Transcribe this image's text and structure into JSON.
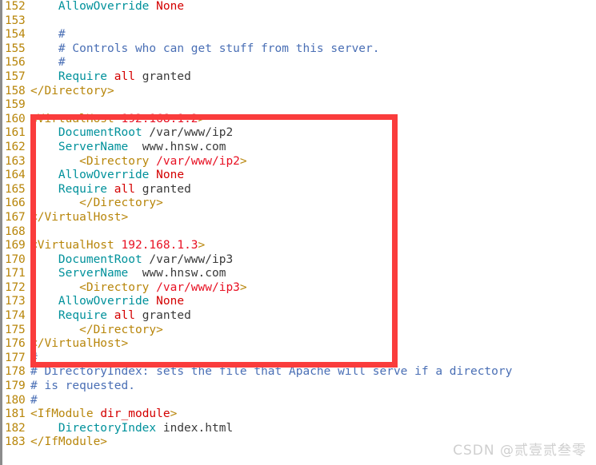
{
  "document": {
    "type": "apache-config",
    "first_visible_line": 152,
    "last_visible_line": 183,
    "watermark": "CSDN @贰壹贰叁零",
    "colors": {
      "background": "#ffffff",
      "gutter_number": "#b8860b",
      "comment": "#4a6fb5",
      "tag": "#b8860b",
      "tag_value": "#e81123",
      "directive": "#00919b",
      "keyword": "#d40000",
      "plain_text": "#3a3a3a",
      "annotation_box": "#fa3c3c",
      "watermark": "#cfcfcf"
    }
  },
  "annotation": {
    "name": "red-highlight-rectangle",
    "covers_lines": "160-176",
    "color": "#fa3c3c"
  },
  "lines": [
    {
      "num": "152",
      "tokens": [
        {
          "t": "plain",
          "v": "    "
        },
        {
          "t": "directive",
          "v": "AllowOverride"
        },
        {
          "t": "plain",
          "v": " "
        },
        {
          "t": "keyword",
          "v": "None"
        }
      ]
    },
    {
      "num": "153",
      "tokens": [
        {
          "t": "plain",
          "v": ""
        }
      ]
    },
    {
      "num": "154",
      "tokens": [
        {
          "t": "comment",
          "v": "    #"
        }
      ]
    },
    {
      "num": "155",
      "tokens": [
        {
          "t": "comment",
          "v": "    # Controls who can get stuff from this server."
        }
      ]
    },
    {
      "num": "156",
      "tokens": [
        {
          "t": "comment",
          "v": "    #"
        }
      ]
    },
    {
      "num": "157",
      "tokens": [
        {
          "t": "plain",
          "v": "    "
        },
        {
          "t": "directive",
          "v": "Require"
        },
        {
          "t": "plain",
          "v": " "
        },
        {
          "t": "keyword",
          "v": "all"
        },
        {
          "t": "plain",
          "v": " granted"
        }
      ]
    },
    {
      "num": "158",
      "tokens": [
        {
          "t": "tag",
          "v": "</Directory>"
        }
      ]
    },
    {
      "num": "159",
      "tokens": [
        {
          "t": "plain",
          "v": ""
        }
      ]
    },
    {
      "num": "160",
      "tokens": [
        {
          "t": "tag",
          "v": "<VirtualHost "
        },
        {
          "t": "tagval",
          "v": "192.168.1.2"
        },
        {
          "t": "tag",
          "v": ">"
        }
      ]
    },
    {
      "num": "161",
      "tokens": [
        {
          "t": "plain",
          "v": "    "
        },
        {
          "t": "directive",
          "v": "DocumentRoot"
        },
        {
          "t": "plain",
          "v": " /var/www/ip2"
        }
      ]
    },
    {
      "num": "162",
      "tokens": [
        {
          "t": "plain",
          "v": "    "
        },
        {
          "t": "directive",
          "v": "ServerName"
        },
        {
          "t": "plain",
          "v": "  www.hnsw.com"
        }
      ]
    },
    {
      "num": "163",
      "tokens": [
        {
          "t": "plain",
          "v": "       "
        },
        {
          "t": "tag",
          "v": "<Directory "
        },
        {
          "t": "tagval",
          "v": "/var/www/ip2"
        },
        {
          "t": "tag",
          "v": ">"
        }
      ]
    },
    {
      "num": "164",
      "tokens": [
        {
          "t": "plain",
          "v": "    "
        },
        {
          "t": "directive",
          "v": "AllowOverride"
        },
        {
          "t": "plain",
          "v": " "
        },
        {
          "t": "keyword",
          "v": "None"
        }
      ]
    },
    {
      "num": "165",
      "tokens": [
        {
          "t": "plain",
          "v": "    "
        },
        {
          "t": "directive",
          "v": "Require"
        },
        {
          "t": "plain",
          "v": " "
        },
        {
          "t": "keyword",
          "v": "all"
        },
        {
          "t": "plain",
          "v": " granted"
        }
      ]
    },
    {
      "num": "166",
      "tokens": [
        {
          "t": "plain",
          "v": "       "
        },
        {
          "t": "tag",
          "v": "</Directory>"
        }
      ]
    },
    {
      "num": "167",
      "tokens": [
        {
          "t": "tag",
          "v": "</VirtualHost>"
        }
      ]
    },
    {
      "num": "168",
      "tokens": [
        {
          "t": "plain",
          "v": ""
        }
      ]
    },
    {
      "num": "169",
      "tokens": [
        {
          "t": "tag",
          "v": "<VirtualHost "
        },
        {
          "t": "tagval",
          "v": "192.168.1.3"
        },
        {
          "t": "tag",
          "v": ">"
        }
      ]
    },
    {
      "num": "170",
      "tokens": [
        {
          "t": "plain",
          "v": "    "
        },
        {
          "t": "directive",
          "v": "DocumentRoot"
        },
        {
          "t": "plain",
          "v": " /var/www/ip3"
        }
      ]
    },
    {
      "num": "171",
      "tokens": [
        {
          "t": "plain",
          "v": "    "
        },
        {
          "t": "directive",
          "v": "ServerName"
        },
        {
          "t": "plain",
          "v": "  www.hnsw.com"
        }
      ]
    },
    {
      "num": "172",
      "tokens": [
        {
          "t": "plain",
          "v": "       "
        },
        {
          "t": "tag",
          "v": "<Directory "
        },
        {
          "t": "tagval",
          "v": "/var/www/ip3"
        },
        {
          "t": "tag",
          "v": ">"
        }
      ]
    },
    {
      "num": "173",
      "tokens": [
        {
          "t": "plain",
          "v": "    "
        },
        {
          "t": "directive",
          "v": "AllowOverride"
        },
        {
          "t": "plain",
          "v": " "
        },
        {
          "t": "keyword",
          "v": "None"
        }
      ]
    },
    {
      "num": "174",
      "tokens": [
        {
          "t": "plain",
          "v": "    "
        },
        {
          "t": "directive",
          "v": "Require"
        },
        {
          "t": "plain",
          "v": " "
        },
        {
          "t": "keyword",
          "v": "all"
        },
        {
          "t": "plain",
          "v": " granted"
        }
      ]
    },
    {
      "num": "175",
      "tokens": [
        {
          "t": "plain",
          "v": "       "
        },
        {
          "t": "tag",
          "v": "</Directory>"
        }
      ]
    },
    {
      "num": "176",
      "tokens": [
        {
          "t": "tag",
          "v": "</VirtualHost>"
        }
      ]
    },
    {
      "num": "177",
      "tokens": [
        {
          "t": "comment",
          "v": "#"
        }
      ]
    },
    {
      "num": "178",
      "tokens": [
        {
          "t": "comment",
          "v": "# DirectoryIndex: sets the file that Apache will serve if a directory"
        }
      ]
    },
    {
      "num": "179",
      "tokens": [
        {
          "t": "comment",
          "v": "# is requested."
        }
      ]
    },
    {
      "num": "180",
      "tokens": [
        {
          "t": "comment",
          "v": "#"
        }
      ]
    },
    {
      "num": "181",
      "tokens": [
        {
          "t": "tag",
          "v": "<IfModule "
        },
        {
          "t": "attr",
          "v": "dir_module"
        },
        {
          "t": "tag",
          "v": ">"
        }
      ]
    },
    {
      "num": "182",
      "tokens": [
        {
          "t": "plain",
          "v": "    "
        },
        {
          "t": "directive",
          "v": "DirectoryIndex"
        },
        {
          "t": "plain",
          "v": " index.html"
        }
      ]
    },
    {
      "num": "183",
      "tokens": [
        {
          "t": "tag",
          "v": "</IfModule>"
        }
      ]
    }
  ]
}
